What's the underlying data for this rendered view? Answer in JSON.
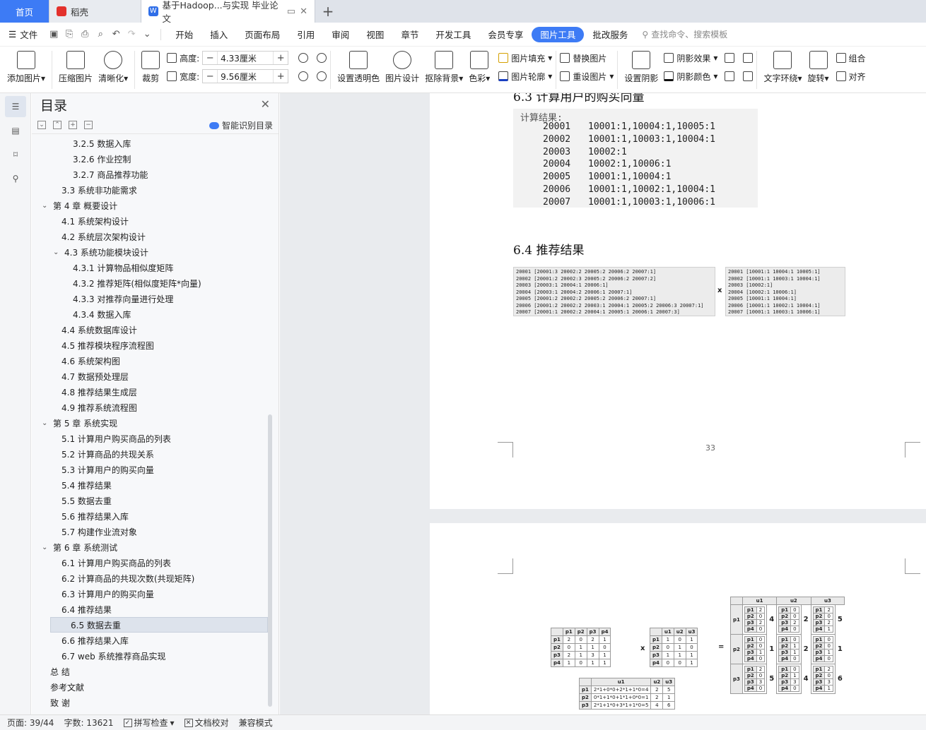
{
  "tabs": {
    "home": "首页",
    "daoke": "稻壳",
    "doc": "基于Hadoop...与实现 毕业论文"
  },
  "menu": {
    "file": "文件",
    "items": [
      "开始",
      "插入",
      "页面布局",
      "引用",
      "审阅",
      "视图",
      "章节",
      "开发工具",
      "会员专享",
      "图片工具",
      "批改服务"
    ],
    "active_index": 9,
    "search_placeholder": "查找命令、搜索模板"
  },
  "ribbon": {
    "add_image": "添加图片",
    "compress": "压缩图片",
    "sharpen": "清晰化",
    "crop": "裁剪",
    "height_label": "高度:",
    "height_value": "4.33厘米",
    "width_label": "宽度:",
    "width_value": "9.56厘米",
    "set_transparent": "设置透明色",
    "image_design": "图片设计",
    "remove_bg": "抠除背景",
    "color": "色彩",
    "fill": "图片填充",
    "outline": "图片轮廓",
    "replace": "替换图片",
    "reset": "重设图片",
    "set_shadow": "设置阴影",
    "shadow_effect": "阴影效果",
    "shadow_color": "阴影颜色",
    "text_wrap": "文字环绕",
    "rotate": "旋转",
    "group": "组合",
    "align": "对齐"
  },
  "toc": {
    "title": "目录",
    "ai_label": "智能识别目录",
    "items": [
      {
        "text": "3.2.5  数据入库",
        "level": 3,
        "caret": ""
      },
      {
        "text": "3.2.6  作业控制",
        "level": 3,
        "caret": ""
      },
      {
        "text": "3.2.7 商品推荐功能",
        "level": 3,
        "caret": ""
      },
      {
        "text": "3.3  系统非功能需求",
        "level": 2,
        "caret": ""
      },
      {
        "text": "第 4 章  概要设计",
        "level": 1,
        "caret": "v"
      },
      {
        "text": "4.1 系统架构设计",
        "level": 2,
        "caret": ""
      },
      {
        "text": "4.2 系统层次架构设计",
        "level": 2,
        "caret": ""
      },
      {
        "text": "4.3 系统功能模块设计",
        "level": 2,
        "caret": "v"
      },
      {
        "text": "4.3.1  计算物品相似度矩阵",
        "level": 3,
        "caret": ""
      },
      {
        "text": "4.3.2 推荐矩阵(相似度矩阵*向量)",
        "level": 3,
        "caret": ""
      },
      {
        "text": "4.3.3 对推荐向量进行处理",
        "level": 3,
        "caret": ""
      },
      {
        "text": "4.3.4 数据入库",
        "level": 3,
        "caret": ""
      },
      {
        "text": "4.4 系统数据库设计",
        "level": 2,
        "caret": ""
      },
      {
        "text": "4.5 推荐模块程序流程图",
        "level": 2,
        "caret": ""
      },
      {
        "text": "4.6 系统架构图",
        "level": 2,
        "caret": ""
      },
      {
        "text": "4.7 数据预处理层",
        "level": 2,
        "caret": ""
      },
      {
        "text": "4.8 推荐结果生成层",
        "level": 2,
        "caret": ""
      },
      {
        "text": "4.9 推荐系统流程图",
        "level": 2,
        "caret": ""
      },
      {
        "text": "第 5 章  系统实现",
        "level": 1,
        "caret": "v"
      },
      {
        "text": "5.1 计算用户购买商品的列表",
        "level": 2,
        "caret": ""
      },
      {
        "text": "5.2 计算商品的共现关系",
        "level": 2,
        "caret": ""
      },
      {
        "text": "5.3 计算用户的购买向量",
        "level": 2,
        "caret": ""
      },
      {
        "text": "5.4 推荐结果",
        "level": 2,
        "caret": ""
      },
      {
        "text": "5.5 数据去重",
        "level": 2,
        "caret": ""
      },
      {
        "text": "5.6 推荐结果入库",
        "level": 2,
        "caret": ""
      },
      {
        "text": "5.7 构建作业流对象",
        "level": 2,
        "caret": ""
      },
      {
        "text": "第 6 章  系统测试",
        "level": 1,
        "caret": "v"
      },
      {
        "text": "6.1 计算用户购买商品的列表",
        "level": 2,
        "caret": ""
      },
      {
        "text": "6.2 计算商品的共现次数(共现矩阵)",
        "level": 2,
        "caret": ""
      },
      {
        "text": "6.3 计算用户的购买向量",
        "level": 2,
        "caret": ""
      },
      {
        "text": "6.4 推荐结果",
        "level": 2,
        "caret": ""
      },
      {
        "text": "6.5 数据去重",
        "level": 2,
        "caret": "",
        "selected": true
      },
      {
        "text": "6.6 推荐结果入库",
        "level": 2,
        "caret": ""
      },
      {
        "text": "6.7 web 系统推荐商品实现",
        "level": 2,
        "caret": ""
      },
      {
        "text": "总    结",
        "level": 1,
        "caret": ""
      },
      {
        "text": "参考文献",
        "level": 1,
        "caret": ""
      },
      {
        "text": "致    谢",
        "level": 1,
        "caret": ""
      }
    ]
  },
  "document": {
    "top_heading": "6.3 计算用户的购买向量",
    "calc_title": "计算结果:",
    "calc_rows": [
      {
        "id": "20001",
        "vec": "10001:1,10004:1,10005:1"
      },
      {
        "id": "20002",
        "vec": "10001:1,10003:1,10004:1"
      },
      {
        "id": "20003",
        "vec": "10002:1"
      },
      {
        "id": "20004",
        "vec": "10002:1,10006:1"
      },
      {
        "id": "20005",
        "vec": "10001:1,10004:1"
      },
      {
        "id": "20006",
        "vec": "10001:1,10002:1,10004:1"
      },
      {
        "id": "20007",
        "vec": "10001:1,10003:1,10006:1"
      }
    ],
    "section_heading": "6.4 推荐结果",
    "left_image_lines": [
      "20001    [20001:3  20002:2  20005:2  20006:2  20007:1]",
      "20002    [20001:2  20002:3  20005:2  20006:2  20007:2]",
      "20003    [20003:1  20004:1  20006:1]",
      "20004    [20003:1  20004:2  20006:1  20007:1]",
      "20005    [20001:2  20002:2  20005:2  20006:2  20007:1]",
      "20006    [20001:2  20002:2  20003:1  20004:1  20005:2  20006:3  20007:1]",
      "20007    [20001:1  20002:2  20004:1  20005:1  20006:1  20007:3]"
    ],
    "mult_sign": "x",
    "right_image_lines": [
      "20001    [10001:1  10004:1  10005:1]",
      "20002    [10001:1  10003:1  10004:1]",
      "20003    [10002:1]",
      "20004    [10002:1  10006:1]",
      "20005    [10001:1  10004:1]",
      "20006    [10001:1  10002:1  10004:1]",
      "20007    [10001:1  10003:1  10006:1]"
    ],
    "page_number": "33",
    "matrixA": {
      "header": [
        "",
        "p1",
        "p2",
        "p3",
        "p4"
      ],
      "rows": [
        [
          "p1",
          "2",
          "0",
          "2",
          "1"
        ],
        [
          "p2",
          "0",
          "1",
          "1",
          "0"
        ],
        [
          "p3",
          "2",
          "1",
          "3",
          "1"
        ],
        [
          "p4",
          "1",
          "0",
          "1",
          "1"
        ]
      ]
    },
    "matrixB": {
      "header": [
        "",
        "u1",
        "u2",
        "u3"
      ],
      "rows": [
        [
          "p1",
          "1",
          "0",
          "1"
        ],
        [
          "p2",
          "0",
          "1",
          "0"
        ],
        [
          "p3",
          "1",
          "1",
          "1"
        ],
        [
          "p4",
          "0",
          "0",
          "1"
        ]
      ]
    },
    "eq_sign": "=",
    "matrixC": {
      "header": [
        "",
        "u1",
        "u2",
        "u3"
      ],
      "rows": [
        [
          "p1",
          "2*1+0*0+2*1+1*0=4",
          "2",
          "5"
        ],
        [
          "p2",
          "0*1+1*0+1*1+0*0=1",
          "2",
          "1"
        ],
        [
          "p3",
          "2*1+1*0+3*1+1*0=5",
          "4",
          "6"
        ]
      ]
    },
    "matrixD": {
      "header": [
        "",
        "u1",
        "u2",
        "u3"
      ],
      "rows": [
        {
          "p": "p1",
          "cells": [
            {
              "sub": [
                [
                  "p1",
                  "2"
                ],
                [
                  "p2",
                  "0"
                ],
                [
                  "p3",
                  "2"
                ],
                [
                  "p4",
                  "0"
                ]
              ],
              "total": "4"
            },
            {
              "sub": [
                [
                  "p1",
                  "0"
                ],
                [
                  "p2",
                  "0"
                ],
                [
                  "p3",
                  "2"
                ],
                [
                  "p4",
                  "0"
                ]
              ],
              "total": "2"
            },
            {
              "sub": [
                [
                  "p1",
                  "2"
                ],
                [
                  "p2",
                  "0"
                ],
                [
                  "p3",
                  "2"
                ],
                [
                  "p4",
                  "1"
                ]
              ],
              "total": "5"
            }
          ]
        },
        {
          "p": "p2",
          "cells": [
            {
              "sub": [
                [
                  "p1",
                  "0"
                ],
                [
                  "p2",
                  "0"
                ],
                [
                  "p3",
                  "1"
                ],
                [
                  "p4",
                  "0"
                ]
              ],
              "total": "1"
            },
            {
              "sub": [
                [
                  "p1",
                  "0"
                ],
                [
                  "p2",
                  "1"
                ],
                [
                  "p3",
                  "1"
                ],
                [
                  "p4",
                  "0"
                ]
              ],
              "total": "2"
            },
            {
              "sub": [
                [
                  "p1",
                  "0"
                ],
                [
                  "p2",
                  "0"
                ],
                [
                  "p3",
                  "1"
                ],
                [
                  "p4",
                  "0"
                ]
              ],
              "total": "1"
            }
          ]
        },
        {
          "p": "p3",
          "cells": [
            {
              "sub": [
                [
                  "p1",
                  "2"
                ],
                [
                  "p2",
                  "0"
                ],
                [
                  "p3",
                  "3"
                ],
                [
                  "p4",
                  "0"
                ]
              ],
              "total": "5"
            },
            {
              "sub": [
                [
                  "p1",
                  "0"
                ],
                [
                  "p2",
                  "1"
                ],
                [
                  "p3",
                  "3"
                ],
                [
                  "p4",
                  "0"
                ]
              ],
              "total": "4"
            },
            {
              "sub": [
                [
                  "p1",
                  "2"
                ],
                [
                  "p2",
                  "0"
                ],
                [
                  "p3",
                  "3"
                ],
                [
                  "p4",
                  "1"
                ]
              ],
              "total": "6"
            }
          ]
        }
      ]
    }
  },
  "status": {
    "page": "页面: 39/44",
    "words": "字数: 13621",
    "spell": "拼写检查",
    "proof": "文档校对",
    "compat": "兼容模式"
  }
}
